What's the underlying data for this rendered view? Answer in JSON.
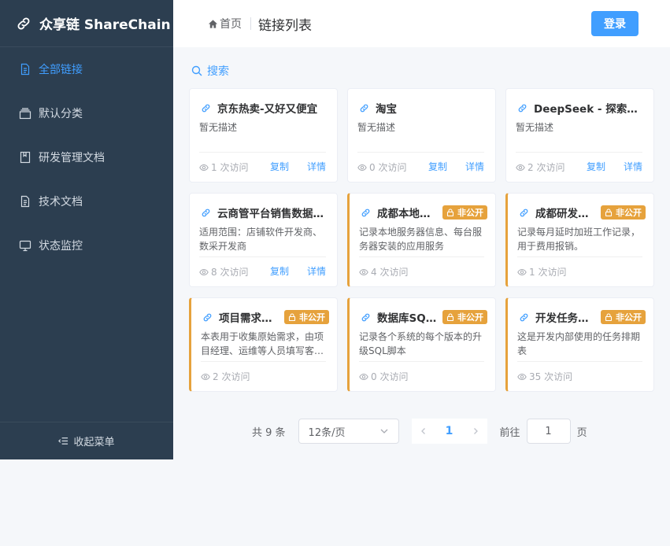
{
  "brand": {
    "name": "众享链 ShareChain"
  },
  "sidebar": {
    "items": [
      {
        "label": "全部链接",
        "icon": "document-icon",
        "active": true
      },
      {
        "label": "默认分类",
        "icon": "folder-icon"
      },
      {
        "label": "研发管理文档",
        "icon": "bookmark-icon"
      },
      {
        "label": "技术文档",
        "icon": "document-icon"
      },
      {
        "label": "状态监控",
        "icon": "monitor-icon"
      }
    ],
    "collapse_label": "收起菜单"
  },
  "header": {
    "home_label": "首页",
    "title": "链接列表",
    "login_label": "登录"
  },
  "search": {
    "label": "搜索"
  },
  "cards": [
    {
      "title": "京东热卖-又好又便宜",
      "desc": "暂无描述",
      "visits": "1 次访问",
      "private": false,
      "copy": "复制",
      "detail": "详情"
    },
    {
      "title": "淘宝",
      "desc": "暂无描述",
      "visits": "0 次访问",
      "private": false,
      "copy": "复制",
      "detail": "详情"
    },
    {
      "title": "DeepSeek - 探索未至之境",
      "desc": "暂无描述",
      "visits": "2 次访问",
      "private": false,
      "copy": "复制",
      "detail": "详情"
    },
    {
      "title": "云商管平台销售数据看板",
      "desc": "适用范围：店铺软件开发商、数采开发商",
      "visits": "8 次访问",
      "private": false,
      "copy": "复制",
      "detail": "详情"
    },
    {
      "title": "成都本地服务器",
      "desc": "记录本地服务器信息、每台服务器安装的应用服务",
      "visits": "4 次访问",
      "private": true,
      "badge": "非公开"
    },
    {
      "title": "成都研发加班",
      "desc": "记录每月延时加班工作记录，用于费用报销。",
      "visits": "1 次访问",
      "private": true,
      "badge": "非公开"
    },
    {
      "title": "项目需求收集",
      "desc": "本表用于收集原始需求，由项目经理、运维等人员填写客户需求",
      "visits": "2 次访问",
      "private": true,
      "badge": "非公开"
    },
    {
      "title": "数据库SQL脚本",
      "desc": "记录各个系统的每个版本的升级SQL脚本",
      "visits": "0 次访问",
      "private": true,
      "badge": "非公开"
    },
    {
      "title": "开发任务排期",
      "desc": "这是开发内部使用的任务排期表",
      "visits": "35 次访问",
      "private": true,
      "badge": "非公开"
    }
  ],
  "pagination": {
    "total_label": "共 9 条",
    "page_size": "12条/页",
    "current_page": "1",
    "goto_label": "前往",
    "goto_value": "1",
    "goto_suffix": "页"
  },
  "colors": {
    "sidebar_bg": "#2c3e50",
    "primary": "#409eff",
    "warning": "#e6a23c"
  }
}
